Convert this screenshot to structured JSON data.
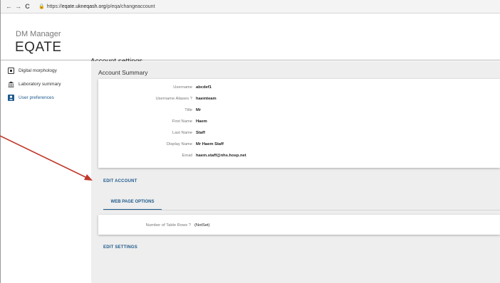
{
  "browser": {
    "back_icon": "←",
    "forward_icon": "→",
    "reload_icon": "C",
    "lock_icon": "🔒",
    "url_prefix": "https://",
    "url_host": "eqate.ukneqash.org",
    "url_path": "/p/eqa/changeaccount"
  },
  "app": {
    "subtitle": "DM Manager",
    "logo": "EQATE",
    "page_title": "Account settings"
  },
  "sidebar": {
    "items": [
      {
        "label": "Digital morphology",
        "icon": "square-dot-icon",
        "active": false
      },
      {
        "label": "Laboratory summary",
        "icon": "bank-icon",
        "active": false
      },
      {
        "label": "User preferences",
        "icon": "person-icon",
        "active": true
      }
    ]
  },
  "summary": {
    "title": "Account Summary",
    "fields": [
      {
        "label": "Username",
        "value": "abcdef1"
      },
      {
        "label": "Username Aliases ?",
        "value": "haemteam"
      },
      {
        "label": "Title",
        "value": "Mr"
      },
      {
        "label": "First Name",
        "value": "Haem"
      },
      {
        "label": "Last Name",
        "value": "Staff"
      },
      {
        "label": "Display Name",
        "value": "Mr Haem Staff"
      },
      {
        "label": "Email",
        "value": "haem.staff@nhs.hosp.net"
      }
    ]
  },
  "actions": {
    "edit_account": "EDIT ACCOUNT",
    "tab_web_page_options": "WEB PAGE OPTIONS",
    "edit_settings": "EDIT SETTINGS"
  },
  "options": {
    "table_rows_label": "Number of Table Rows ?",
    "table_rows_value": "(NotSet)"
  },
  "colors": {
    "accent": "#1e5a8c",
    "annotation_arrow": "#c0392b",
    "main_background": "#eeeeee"
  }
}
